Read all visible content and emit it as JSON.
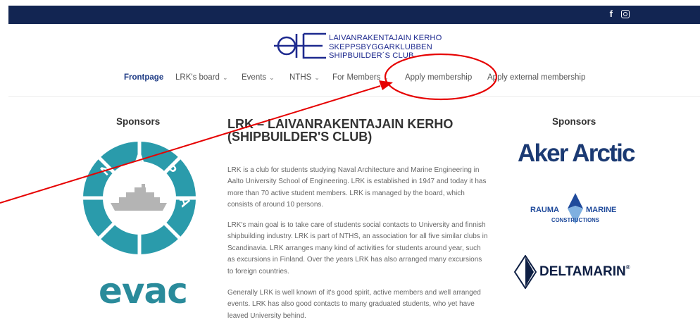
{
  "social": {
    "facebook": "f"
  },
  "logo": {
    "lines": [
      "LAIVANRAKENTAJAIN KERHO",
      "SKEPPSBYGGARKLUBBEN",
      "SHIPBUILDER´S CLUB"
    ]
  },
  "nav": {
    "items": [
      {
        "label": "Frontpage",
        "dropdown": false,
        "active": true
      },
      {
        "label": "LRK's board",
        "dropdown": true
      },
      {
        "label": "Events",
        "dropdown": true
      },
      {
        "label": "NTHS",
        "dropdown": true
      },
      {
        "label": "For Members",
        "dropdown": true
      },
      {
        "label": "Apply membership",
        "dropdown": false
      },
      {
        "label": "Apply external membership",
        "dropdown": false
      }
    ],
    "chevron": "⌄"
  },
  "left_sidebar": {
    "title": "Sponsors",
    "sponsors": [
      {
        "logo_text": [
          "N",
          "A",
          "P",
          "A"
        ]
      },
      {
        "logo_text": "evac"
      }
    ]
  },
  "right_sidebar": {
    "title": "Sponsors",
    "sponsors": [
      {
        "logo_text": "Aker Arctic"
      },
      {
        "logo_text_left": "RAUMA",
        "logo_text_right": "MARINE",
        "logo_subtext": "CONSTRUCTIONS"
      },
      {
        "logo_text": "DELTAMARIN",
        "mark": "®"
      }
    ]
  },
  "main": {
    "title": "LRK – LAIVANRAKENTAJAIN KERHO (SHIPBUILDER'S CLUB)",
    "paragraphs": [
      "LRK is a club for students studying Naval Architecture and Marine Engineering in Aalto University School of Engineering. LRK is established in 1947 and today it has more than 70 active student members. LRK is managed by the board, which consists of around 10 persons.",
      "LRK's main goal is to take care of students social contacts to University and finnish shipbuilding industry. LRK is part of NTHS, an association for all five similar clubs in Scandinavia. LRK arranges many kind of activities for students around year, such as excursions in Finland. Over the years LRK has also arranged many excursions to foreign countries.",
      "Generally LRK is well known of it's good spirit, active members and well arranged events. LRK has also good contacts to many graduated students, who yet have leaved University behind."
    ]
  },
  "colors": {
    "topbar": "#122552",
    "annotation": "#e60000",
    "nav_active": "#1e3b85",
    "napa": "#2a9bab",
    "evac": "#2a8b9b",
    "aker": "#1b3a73"
  }
}
